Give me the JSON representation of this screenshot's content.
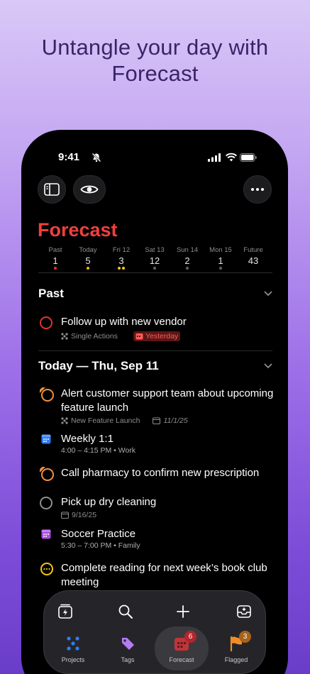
{
  "headline": "Untangle your day with Forecast",
  "status": {
    "time": "9:41"
  },
  "page_title": "Forecast",
  "days": [
    {
      "label": "Past",
      "count": "1",
      "dots": [
        "#e0342f"
      ]
    },
    {
      "label": "Today",
      "count": "5",
      "dots": [
        "#f5b800"
      ]
    },
    {
      "label": "Fri 12",
      "count": "3",
      "dots": [
        "#f5c518",
        "#f5c518"
      ]
    },
    {
      "label": "Sat 13",
      "count": "12",
      "dots": [
        "#636366"
      ]
    },
    {
      "label": "Sun 14",
      "count": "2",
      "dots": [
        "#636366"
      ]
    },
    {
      "label": "Mon 15",
      "count": "1",
      "dots": [
        "#636366"
      ]
    },
    {
      "label": "Future",
      "count": "43",
      "dots": []
    }
  ],
  "sections": {
    "past": {
      "title": "Past"
    },
    "today": {
      "title": "Today — Thu, Sep 11"
    }
  },
  "tasks": {
    "t1": {
      "title": "Follow up with new vendor",
      "project": "Single Actions",
      "due": "Yesterday"
    },
    "t2": {
      "title": "Alert customer support team about upcoming feature launch",
      "project": "New Feature Launch",
      "date": "11/1/25"
    },
    "e1": {
      "title": "Weekly 1:1",
      "time": "4:00 – 4:15 PM • Work"
    },
    "t3": {
      "title": "Call pharmacy to confirm new prescription"
    },
    "t4": {
      "title": "Pick up dry cleaning",
      "date": "9/16/25"
    },
    "e2": {
      "title": "Soccer Practice",
      "time": "5:30 – 7:00 PM • Family"
    },
    "t5": {
      "title": "Complete reading for next week’s book club meeting"
    }
  },
  "tabbar": {
    "tabs": [
      {
        "label": "Projects",
        "badge": ""
      },
      {
        "label": "Tags",
        "badge": ""
      },
      {
        "label": "Forecast",
        "badge": "6"
      },
      {
        "label": "Flagged",
        "badge": "3"
      }
    ]
  },
  "colors": {
    "accent_red": "#f23e3e",
    "due_orange": "#f2913d",
    "flag_orange": "#f28c28",
    "tag_purple": "#b57cf2",
    "projects_blue": "#2f7df6"
  }
}
